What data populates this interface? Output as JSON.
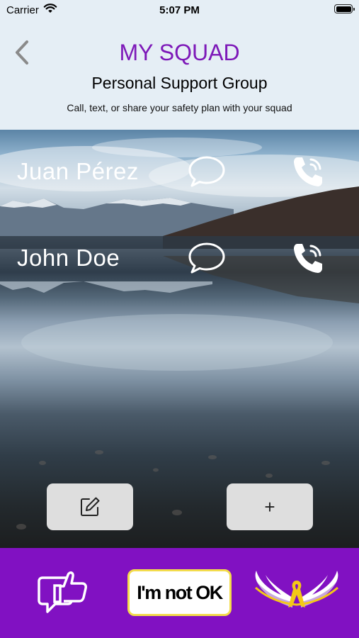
{
  "status_bar": {
    "carrier": "Carrier",
    "time": "5:07 PM"
  },
  "header": {
    "title": "MY SQUAD",
    "subtitle": "Personal Support Group",
    "description": "Call, text, or share your safety plan with your squad"
  },
  "contacts": [
    {
      "name": "Juan Pérez"
    },
    {
      "name": "John Doe"
    }
  ],
  "actions": {
    "add_label": "+"
  },
  "bottom_bar": {
    "not_ok_label": "I'm not OK"
  },
  "colors": {
    "accent": "#7d18b8",
    "bottom_bar": "#8111c2",
    "header_bg": "#e5eef5",
    "button_border": "#f3dc4b"
  }
}
